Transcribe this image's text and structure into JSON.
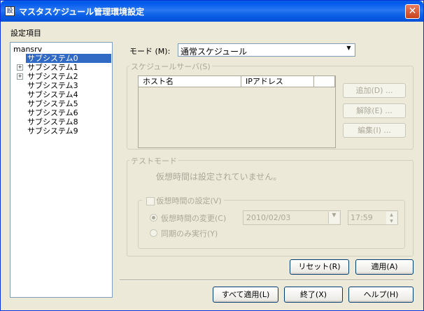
{
  "window": {
    "title": "マスタスケジュール管理環境設定",
    "icon_text": "設"
  },
  "left": {
    "label": "設定項目",
    "tree": {
      "root": "mansrv",
      "items": [
        {
          "label": "サブシステム0",
          "expandable": false,
          "selected": true
        },
        {
          "label": "サブシステム1",
          "expandable": true
        },
        {
          "label": "サブシステム2",
          "expandable": true
        },
        {
          "label": "サブシステム3",
          "expandable": false
        },
        {
          "label": "サブシステム4",
          "expandable": false
        },
        {
          "label": "サブシステム5",
          "expandable": false
        },
        {
          "label": "サブシステム6",
          "expandable": false
        },
        {
          "label": "サブシステム8",
          "expandable": false
        },
        {
          "label": "サブシステム9",
          "expandable": false
        }
      ]
    }
  },
  "mode": {
    "label": "モード (M):",
    "value": "通常スケジュール"
  },
  "schedule_server": {
    "group_label": "スケジュールサーバ(S)",
    "columns": [
      "ホスト名",
      "IPアドレス"
    ],
    "add": "追加(D) ...",
    "remove": "解除(E) ...",
    "edit": "編集(I) ..."
  },
  "test_mode": {
    "group_label": "テストモード",
    "status": "仮想時間は設定されていません。",
    "virtual_time_setting": "仮想時間の設定(V)",
    "change_label": "仮想時間の変更(C)",
    "date_value": "2010/02/03",
    "time_value": "17:59",
    "sync_only": "同期のみ実行(Y)"
  },
  "buttons": {
    "reset": "リセット(R)",
    "apply": "適用(A)",
    "apply_all": "すべて適用(L)",
    "exit": "終了(X)",
    "help": "ヘルプ(H)"
  }
}
